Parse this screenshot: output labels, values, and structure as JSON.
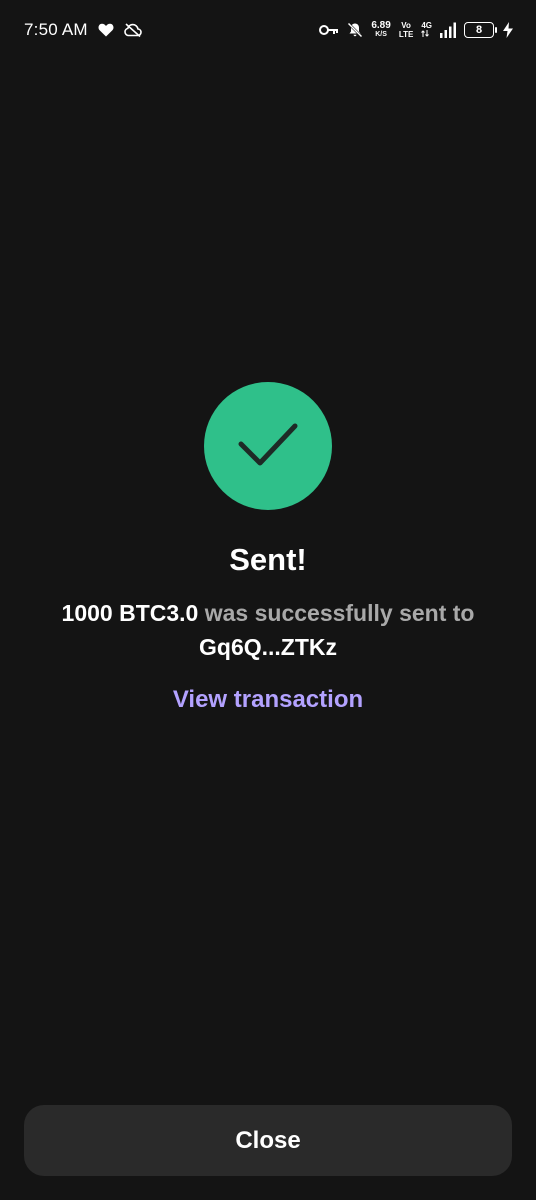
{
  "status_bar": {
    "time": "7:50 AM",
    "net_speed_value": "6.89",
    "net_speed_unit": "K/S",
    "volte_top": "Vo",
    "volte_bottom": "LTE",
    "network_type": "4G",
    "battery_level": "8",
    "icons": [
      "heart-icon",
      "cloud-off-icon",
      "key-icon",
      "bell-off-icon",
      "signal-icon",
      "battery-icon",
      "charging-icon"
    ]
  },
  "success": {
    "icon": "check-icon",
    "accent_color": "#2fc08a",
    "title": "Sent!",
    "amount": "1000 BTC3.0",
    "middle_text": " was successfully sent to ",
    "recipient": "Gq6Q...ZTKz",
    "view_link": "View transaction",
    "link_color": "#b3a2ff"
  },
  "footer": {
    "close_label": "Close"
  }
}
